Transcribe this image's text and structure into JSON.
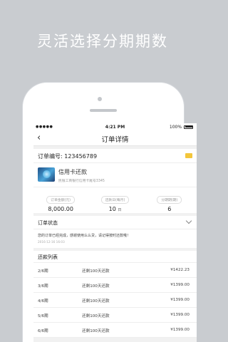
{
  "headline": "灵活选择分期期数",
  "status_bar": {
    "signal": "●●●●● ",
    "time": "4:21 PM",
    "battery": "100%"
  },
  "nav": {
    "back": "‹",
    "title": "订单详情"
  },
  "order": {
    "number_label": "订单编号: 123456789",
    "product_name": "信用卡还款",
    "product_sub": "民银工商银行信用卡尾号3345",
    "stats": [
      {
        "label": "订单金额(元)",
        "value": "8,000.00",
        "unit": ""
      },
      {
        "label": "还款日(每月)",
        "value": "10",
        "unit": "日"
      },
      {
        "label": "分期期(期)",
        "value": "6",
        "unit": ""
      }
    ]
  },
  "status_section": {
    "title": "订单状态",
    "message": "您的订单已经完成，感谢使用么么贷，请记得按时还款哦！",
    "timestamp": "2016-12-16 16:03"
  },
  "repayment": {
    "title": "还款列表",
    "rows": [
      {
        "period": "2/6期",
        "desc": "还剩100天还款",
        "amount": "¥1422.23"
      },
      {
        "period": "3/6期",
        "desc": "还剩100天还款",
        "amount": "¥1399.00"
      },
      {
        "period": "4/6期",
        "desc": "还剩100天还款",
        "amount": "¥1399.00"
      },
      {
        "period": "5/6期",
        "desc": "还剩100天还款",
        "amount": "¥1399.00"
      },
      {
        "period": "6/6期",
        "desc": "还剩100天还款",
        "amount": "¥1399.00"
      }
    ]
  }
}
